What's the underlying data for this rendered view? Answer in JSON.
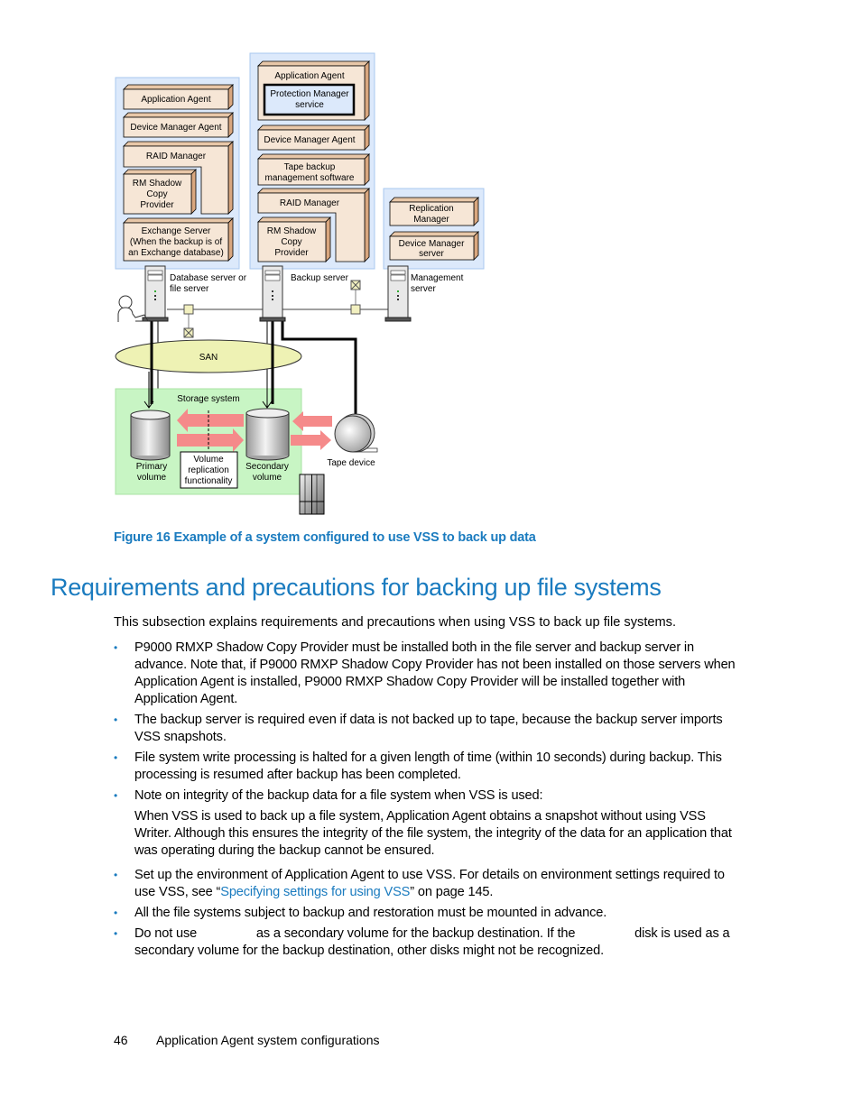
{
  "diagram": {
    "db_server_stack": {
      "application_agent": "Application Agent",
      "device_manager_agent": "Device Manager Agent",
      "raid_manager": "RAID Manager",
      "rm_shadow_copy_provider": [
        "RM Shadow",
        "Copy",
        "Provider"
      ],
      "exchange_server": [
        "Exchange Server",
        "(When the backup is of",
        "an Exchange database)"
      ]
    },
    "backup_server_stack": {
      "application_agent": "Application Agent",
      "protection_manager_service": [
        "Protection Manager",
        "service"
      ],
      "device_manager_agent": "Device Manager Agent",
      "tape_backup": [
        "Tape backup",
        "management software"
      ],
      "raid_manager": "RAID Manager",
      "rm_shadow_copy_provider": [
        "RM Shadow",
        "Copy",
        "Provider"
      ]
    },
    "management_server_stack": {
      "replication_manager": [
        "Replication",
        "Manager"
      ],
      "device_manager_server": [
        "Device Manager",
        "server"
      ]
    },
    "labels": {
      "db_server": [
        "Database server or",
        "file server"
      ],
      "backup_server": "Backup server",
      "management_server": [
        "Management",
        "server"
      ],
      "san": "SAN",
      "storage_system": "Storage system",
      "primary_volume": [
        "Primary",
        "volume"
      ],
      "secondary_volume": [
        "Secondary",
        "volume"
      ],
      "volume_replication": [
        "Volume",
        "replication",
        "functionality"
      ],
      "tape_device": "Tape device"
    },
    "colors": {
      "stack_panel": "#dce9fb",
      "component_face": "#f6e6d6",
      "component_side": "#d9a77f",
      "san": "#eef2b4",
      "storage": "#c8f5c4",
      "arrow": "#f58a8a"
    }
  },
  "caption": "Figure 16 Example of a system configured to use VSS to back up data",
  "heading": "Requirements and precautions for backing up file systems",
  "intro": "This subsection explains requirements and precautions when using VSS to back up file systems.",
  "bullets": [
    {
      "text": "P9000 RMXP Shadow Copy Provider must be installed both in the file server and backup server in advance. Note that, if P9000 RMXP Shadow Copy Provider has not been installed on those servers when Application Agent is installed, P9000 RMXP Shadow Copy Provider will be installed together with Application Agent."
    },
    {
      "text": "The backup server is required even if data is not backed up to tape, because the backup server imports VSS snapshots."
    },
    {
      "text": "File system write processing is halted for a given length of time (within 10 seconds) during backup. This processing is resumed after backup has been completed."
    },
    {
      "text": "Note on integrity of the backup data for a file system when VSS is used:",
      "sub": "When VSS is used to back up a file system, Application Agent obtains a snapshot without using VSS Writer. Although this ensures the integrity of the file system, the integrity of the data for an application that was operating during the backup cannot be ensured."
    },
    {
      "before": "Set up the environment of Application Agent to use VSS. For details on environment settings required to use VSS, see “",
      "link": "Specifying settings for using VSS",
      "after": "” on page 145."
    },
    {
      "text": "All the file systems subject to backup and restoration must be mounted in advance."
    },
    {
      "part1": "Do not use ",
      "part2": " as a secondary volume for the backup destination. If the ",
      "part3": " disk is used as a secondary volume for the backup destination, other disks might not be recognized."
    }
  ],
  "footer": {
    "page_number": "46",
    "section": "Application Agent system configurations"
  }
}
